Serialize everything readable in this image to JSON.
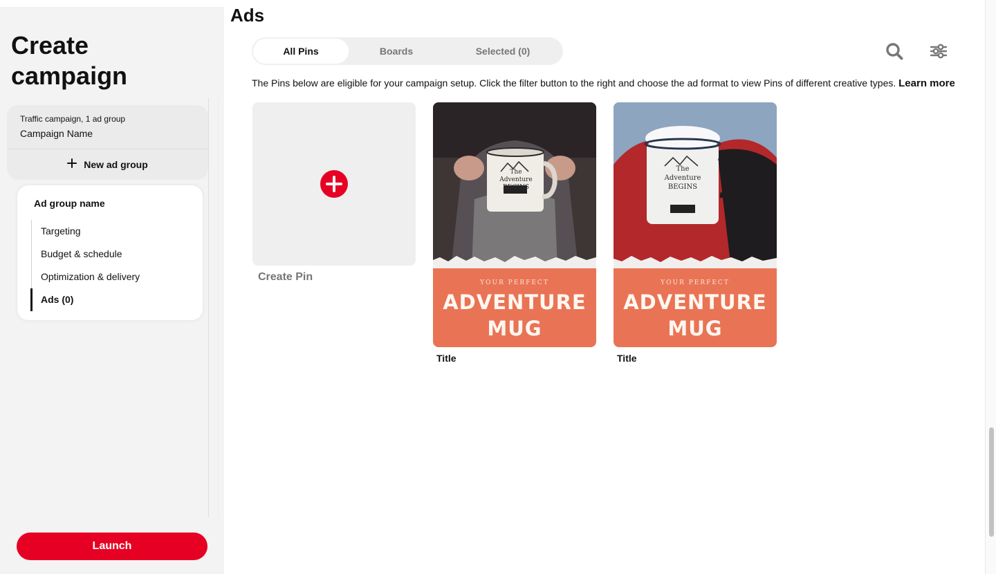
{
  "sidebar": {
    "title": "Create campaign",
    "campaign": {
      "type": "Traffic campaign, 1 ad group",
      "name": "Campaign Name"
    },
    "new_ad_group_label": "New ad group",
    "ad_group": {
      "name": "Ad group name",
      "nav": [
        {
          "label": "Targeting"
        },
        {
          "label": "Budget & schedule"
        },
        {
          "label": "Optimization & delivery"
        },
        {
          "label": "Ads (0)"
        }
      ]
    },
    "launch_label": "Launch"
  },
  "main": {
    "title": "Ads",
    "tabs": [
      {
        "label": "All Pins"
      },
      {
        "label": "Boards"
      },
      {
        "label": "Selected (0)"
      }
    ],
    "active_tab": "All Pins",
    "icons": {
      "search": "search-icon",
      "filter": "filter-sliders-icon"
    },
    "description": "The Pins below are eligible for your campaign setup. Click the filter button to the right and choose the ad format to view Pins of different creative types.",
    "learn_more": "Learn more",
    "create_pin_label": "Create Pin",
    "pins": [
      {
        "kicker": "YOUR PERFECT",
        "headline": "ADVENTURE",
        "headline2": "MUG",
        "mug_text": "The Adventure BEGINS",
        "title": "Title"
      },
      {
        "kicker": "YOUR PERFECT",
        "headline": "ADVENTURE",
        "headline2": "MUG",
        "mug_text": "The Adventure BEGINS",
        "title": "Title"
      }
    ]
  },
  "colors": {
    "brand_red": "#e60023",
    "pin_orange": "#e97455",
    "sidebar_bg": "#f3f3f3"
  }
}
